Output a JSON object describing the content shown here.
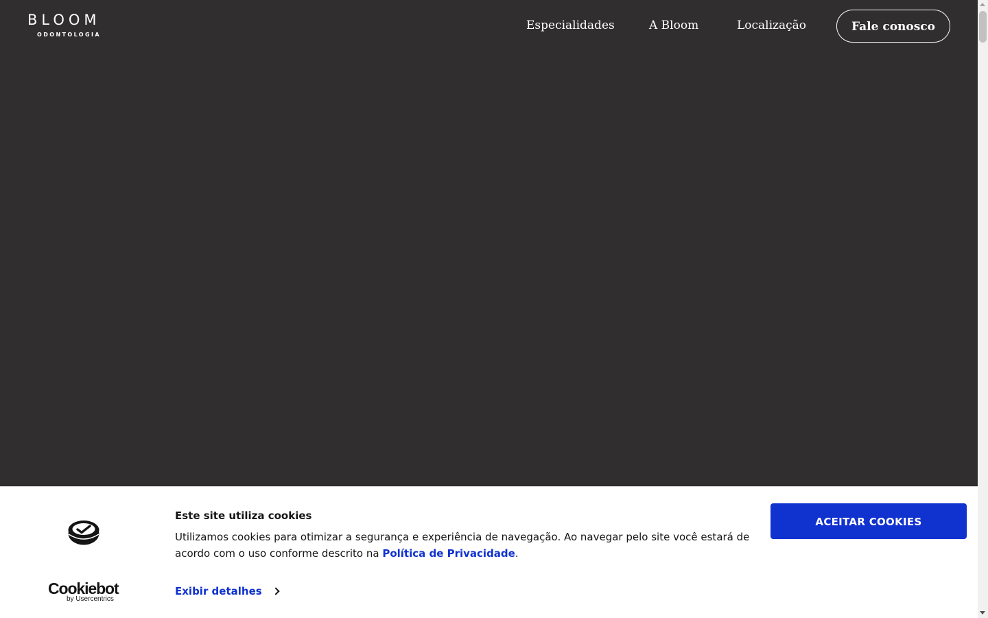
{
  "brand": {
    "name": "BLOOM",
    "tagline": "ODONTOLOGIA"
  },
  "nav": {
    "items": [
      {
        "label": "Especialidades"
      },
      {
        "label": "A Bloom"
      },
      {
        "label": "Localização"
      }
    ],
    "cta_label": "Fale conosco"
  },
  "cookie_banner": {
    "provider_name": "Cookiebot",
    "provider_sub": "by Usercentrics",
    "provider_icon": "cookiebot-icon",
    "title": "Este site utiliza cookies",
    "text_before_link": "Utilizamos cookies para otimizar a segurança e experiência de navegação. Ao navegar pelo site você estará de acordo com o uso conforme descrito na ",
    "link_label": "Política de Privacidade",
    "text_after_link": ".",
    "details_label": "Exibir detalhes",
    "accept_label": "ACEITAR COOKIES"
  },
  "colors": {
    "page_background": "#302e2f",
    "accent": "#1032cf",
    "banner_background": "#ffffff",
    "text_dark": "#141414"
  }
}
